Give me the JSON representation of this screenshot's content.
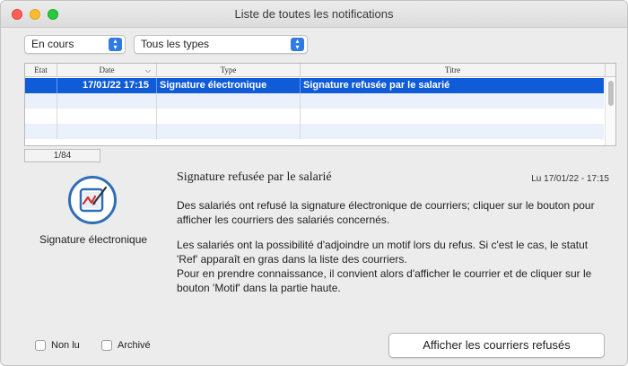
{
  "window": {
    "title": "Liste de toutes les notifications"
  },
  "filters": {
    "status": "En cours",
    "type": "Tous les types"
  },
  "table": {
    "columns": [
      "Etat",
      "Date",
      "Type",
      "Titre"
    ],
    "rows": [
      {
        "etat": "",
        "date": "17/01/22   17:15",
        "type": "Signature électronique",
        "titre": "Signature refusée par le salarié",
        "selected": true
      }
    ]
  },
  "counter": "1/84",
  "detail": {
    "icon_label": "Signature électronique",
    "title": "Signature refusée par le salarié",
    "date": "Lu  17/01/22 - 17:15",
    "paragraph1": "Des salariés ont refusé la signature électronique de courriers; cliquer sur le bouton pour afficher les courriers des salariés concernés.",
    "paragraph2_line1": "Les salariés ont la possibilité d'adjoindre un motif lors du refus. Si c'est le cas, le statut 'Ref' apparaît en gras dans la liste des courriers.",
    "paragraph2_line2": "Pour en prendre connaissance, il convient alors d'afficher le courrier et de cliquer sur le bouton 'Motif' dans la partie haute."
  },
  "checkboxes": {
    "unread": "Non lu",
    "archived": "Archivé"
  },
  "action_button": "Afficher les courriers refusés",
  "colors": {
    "selection": "#0f5bd8",
    "accent": "#2f7ae5",
    "icon_ring": "#2f6fb7"
  }
}
